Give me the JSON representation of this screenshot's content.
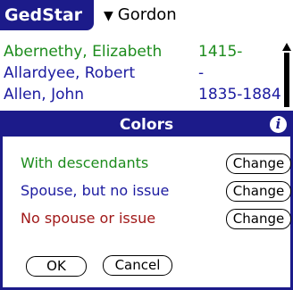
{
  "app": {
    "title": "GedStar",
    "dropdown_label": "Gordon"
  },
  "list": {
    "rows": [
      {
        "name": "Abernethy, Elizabeth",
        "dates": "1415-",
        "status": "desc"
      },
      {
        "name": "Allardyee, Robert",
        "dates": "-",
        "status": "spouse"
      },
      {
        "name": "Allen, John",
        "dates": "1835-1884",
        "status": "spouse"
      }
    ]
  },
  "dialog": {
    "title": "Colors",
    "info_glyph": "i",
    "options": [
      {
        "label": "With descendants",
        "button": "Change",
        "color": "#1d8c1d"
      },
      {
        "label": "Spouse, but no issue",
        "button": "Change",
        "color": "#1c1ba0"
      },
      {
        "label": "No spouse or issue",
        "button": "Change",
        "color": "#a01818"
      }
    ],
    "ok_label": "OK",
    "cancel_label": "Cancel"
  },
  "colors": {
    "accent": "#1c1b8a",
    "descendants": "#1d8c1d",
    "spouse": "#1c1ba0",
    "none": "#a01818"
  }
}
